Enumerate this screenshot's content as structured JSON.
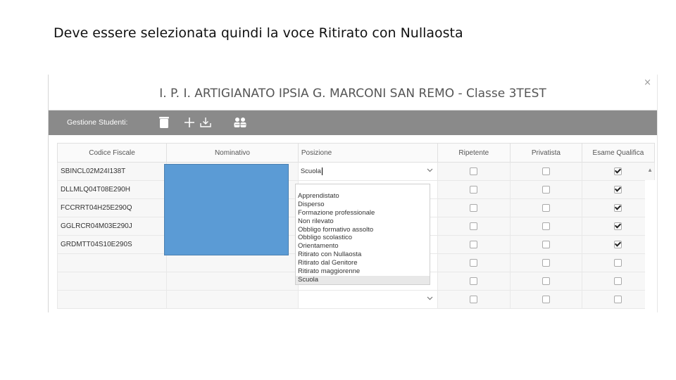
{
  "caption": "Deve essere selezionata quindi la voce Ritirato con Nullaosta",
  "window": {
    "close_glyph": "×",
    "title": "I. P. I. ARTIGIANATO IPSIA G. MARCONI SAN REMO - Classe 3TEST"
  },
  "toolbar": {
    "label": "Gestione Studenti:",
    "icons": [
      "trash-icon",
      "add-icon",
      "download-icon",
      "users-icon"
    ],
    "color": "#8a8a8a"
  },
  "table": {
    "headers": [
      "Codice Fiscale",
      "Nominativo",
      "Posizione",
      "Ripetente",
      "Privatista",
      "Esame Qualifica"
    ],
    "rows": [
      {
        "cf": "SBINCL02M24I138T",
        "posizione": "Scuola",
        "ripetente": false,
        "privatista": false,
        "qualifica": true
      },
      {
        "cf": "DLLMLQ04T08E290H",
        "posizione": "",
        "ripetente": false,
        "privatista": false,
        "qualifica": true
      },
      {
        "cf": "FCCRRT04H25E290Q",
        "posizione": "",
        "ripetente": false,
        "privatista": false,
        "qualifica": true
      },
      {
        "cf": "GGLRCR04M03E290J",
        "posizione": "",
        "ripetente": false,
        "privatista": false,
        "qualifica": true
      },
      {
        "cf": "GRDMTT04S10E290S",
        "posizione": "",
        "ripetente": false,
        "privatista": false,
        "qualifica": true
      },
      {
        "cf": "",
        "posizione": "",
        "ripetente": false,
        "privatista": false,
        "qualifica": false
      },
      {
        "cf": "",
        "posizione": "",
        "ripetente": false,
        "privatista": false,
        "qualifica": false
      },
      {
        "cf": "",
        "posizione": "",
        "ripetente": false,
        "privatista": false,
        "qualifica": false
      }
    ]
  },
  "dropdown": {
    "options": [
      "Apprendistato",
      "Disperso",
      "Formazione professionale",
      "Non rilevato",
      "Obbligo formativo assolto",
      "Obbligo scolastico",
      "Orientamento",
      "Ritirato con Nullaosta",
      "Ritirato dal Genitore",
      "Ritirato maggiorenne",
      "Scuola"
    ],
    "selected": "Scuola"
  },
  "colors": {
    "redaction": "#5b9bd5",
    "header_bg": "#fafafa",
    "cell_bg": "#f7f7f7"
  }
}
